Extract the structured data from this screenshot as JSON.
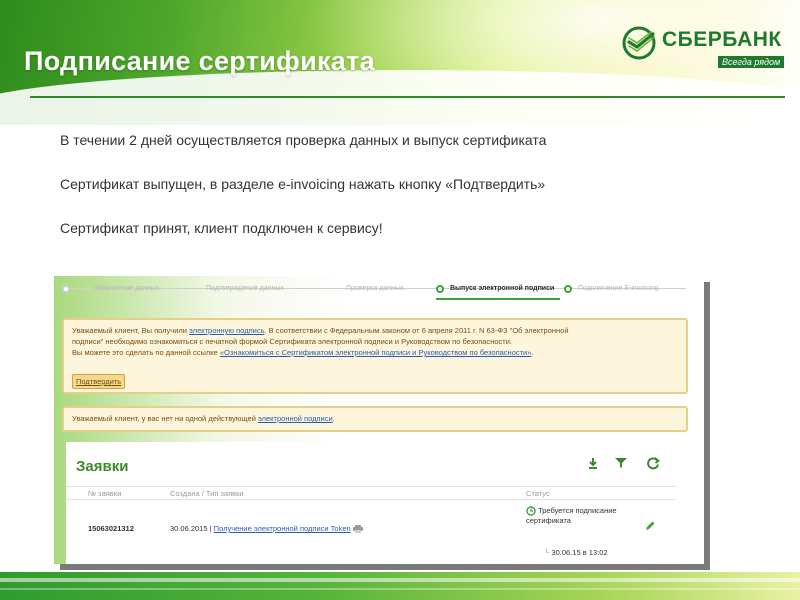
{
  "slide": {
    "title": "Подписание сертификата"
  },
  "logo": {
    "name": "СБЕРБАНК",
    "slogan": "Всегда рядом",
    "brand_color": "#1f7a2e"
  },
  "steps": [
    "В течении 2 дней осуществляется проверка данных и выпуск сертификата",
    "Сертификат выпущен, в разделе e-invoicing нажать кнопку  «Подтвердить»",
    "Сертификат принят, клиент  подключен к сервису!"
  ],
  "screenshot": {
    "progress_steps": [
      "Заполнение данных",
      "Подтверждение данных",
      "Проверка данных",
      "Выпуск электронной подписи",
      "Подключение E-invoicing"
    ],
    "active_step": "Выпуск электронной подписи",
    "notice_1": {
      "line1_a": "Уважаемый клиент, Вы получили ",
      "line1_link": "электронную подпись",
      "line1_b": ". В соответствии с Федеральным законом от 6 апреля 2011 г. N 63-ФЗ \"Об электронной",
      "line2": "подписи\" необходимо ознакомиться с печатной формой Сертификата электронной подписи и Руководством по безопасности.",
      "line3_a": "Вы можете это сделать по данной ссылке ",
      "line3_link": "«Ознакомиться с Сертификатом электронной подписи и Руководством по безопасности»",
      "line3_b": ".",
      "confirm_button": "Подтвердить"
    },
    "notice_2": {
      "text_a": "Уважаемый клиент, у вас нет ни одной действующей ",
      "text_link": "электронной подписи",
      "text_b": "."
    },
    "orders": {
      "title": "Заявки",
      "tools": [
        "download-icon",
        "filter-icon",
        "refresh-icon"
      ],
      "columns": [
        "№ заявки",
        "Создана / Тип заявки",
        "Статус"
      ],
      "rows": [
        {
          "number": "15063021312",
          "created": "30.06.2015",
          "separator": " | ",
          "type": "Получение электронной подписи Token",
          "status": "Требуется подписание сертификата",
          "status_date": "30.06.15 в 13:02"
        }
      ]
    }
  }
}
